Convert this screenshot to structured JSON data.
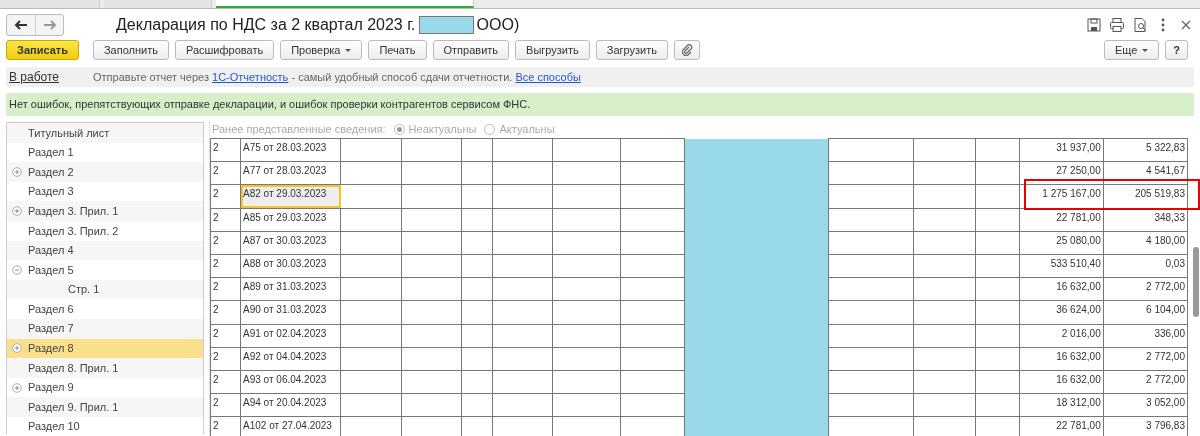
{
  "top_tabs": [
    {
      "selected": false
    },
    {
      "selected": false
    },
    {
      "selected": true
    }
  ],
  "window": {
    "title_before": "Декларация по НДС за 2 квартал 2023 г.",
    "title_after": "ООО)"
  },
  "toolbar": {
    "buttons": [
      {
        "label": "Записать",
        "kind": "primary"
      },
      {
        "label": "Заполнить",
        "kind": "plain"
      },
      {
        "label": "Расшифровать",
        "kind": "plain"
      },
      {
        "label": "Проверка",
        "kind": "dropdown"
      },
      {
        "label": "Печать",
        "kind": "plain"
      },
      {
        "label": "Отправить",
        "kind": "plain"
      },
      {
        "label": "Выгрузить",
        "kind": "plain"
      },
      {
        "label": "Загрузить",
        "kind": "plain"
      },
      {
        "kind": "attach"
      }
    ],
    "right_buttons": [
      {
        "label": "Еще",
        "kind": "dropdown"
      },
      {
        "label": "?",
        "kind": "help"
      }
    ]
  },
  "info_bar": {
    "status": "В работе",
    "text_before": "Отправьте отчет через",
    "link": "1С-Отчетность",
    "text_after": "- самый удобный способ сдачи отчетности.",
    "link_all": "Все способы"
  },
  "message": "Нет ошибок, препятствующих отправке декларации, и ошибок проверки контрагентов сервисом ФНС.",
  "sidebar": {
    "items": [
      {
        "label": "Титульный лист",
        "selected": false
      },
      {
        "label": "Раздел 1",
        "selected": false
      },
      {
        "label": "Раздел 2",
        "selected": false,
        "expanded": false
      },
      {
        "label": "Раздел 3",
        "selected": false
      },
      {
        "label": "Раздел 3. Прил. 1",
        "selected": false,
        "expanded": false
      },
      {
        "label": "Раздел 3. Прил. 2",
        "selected": false
      },
      {
        "label": "Раздел 4",
        "selected": false
      },
      {
        "label": "Раздел 5",
        "selected": false,
        "expanded": true,
        "children": [
          {
            "label": "Стр. 1",
            "selected": false
          }
        ]
      },
      {
        "label": "Раздел 6",
        "selected": false
      },
      {
        "label": "Раздел 7",
        "selected": false
      },
      {
        "label": "Раздел 8",
        "selected": true,
        "expanded": false
      },
      {
        "label": "Раздел 8. Прил. 1",
        "selected": false
      },
      {
        "label": "Раздел 9",
        "selected": false,
        "expanded": false
      },
      {
        "label": "Раздел 9. Прил. 1",
        "selected": false
      },
      {
        "label": "Раздел 10",
        "selected": false
      }
    ]
  },
  "previous_info": {
    "label": "Ранее представленные сведения:",
    "disabled": true,
    "options": [
      {
        "label": "Неактуальны",
        "selected": true
      },
      {
        "label": "Актуальны",
        "selected": false
      }
    ]
  },
  "table": {
    "rows": [
      {
        "column_1": "2",
        "document": "А75 от 28.03.2023",
        "amount": "31 937,00",
        "tax": "5 322,83",
        "selected": false,
        "marked": false
      },
      {
        "column_1": "2",
        "document": "А77 от 28.03.2023",
        "amount": "27 250,00",
        "tax": "4 541,67",
        "selected": false,
        "marked": false
      },
      {
        "column_1": "2",
        "document": "А82 от 29.03.2023",
        "amount": "1 275 167,00",
        "tax": "205 519,83",
        "selected": true,
        "marked": true
      },
      {
        "column_1": "2",
        "document": "А85 от 29.03.2023",
        "amount": "22 781,00",
        "tax": "348,33",
        "selected": false,
        "marked": false
      },
      {
        "column_1": "2",
        "document": "А87 от 30.03.2023",
        "amount": "25 080,00",
        "tax": "4 180,00",
        "selected": false,
        "marked": false
      },
      {
        "column_1": "2",
        "document": "А88 от 30.03.2023",
        "amount": "533 510,40",
        "tax": "0,03",
        "selected": false,
        "marked": false
      },
      {
        "column_1": "2",
        "document": "А89 от 31.03.2023",
        "amount": "16 632,00",
        "tax": "2 772,00",
        "selected": false,
        "marked": false
      },
      {
        "column_1": "2",
        "document": "А90 от 31.03.2023",
        "amount": "36 624,00",
        "tax": "6 104,00",
        "selected": false,
        "marked": false
      },
      {
        "column_1": "2",
        "document": "А91 от 02.04.2023",
        "amount": "2 016,00",
        "tax": "336,00",
        "selected": false,
        "marked": false
      },
      {
        "column_1": "2",
        "document": "А92 от 04.04.2023",
        "amount": "16 632,00",
        "tax": "2 772,00",
        "selected": false,
        "marked": false
      },
      {
        "column_1": "2",
        "document": "А93 от 06.04.2023",
        "amount": "16 632,00",
        "tax": "2 772,00",
        "selected": false,
        "marked": false
      },
      {
        "column_1": "2",
        "document": "А94 от 20.04.2023",
        "amount": "18 312,00",
        "tax": "3 052,00",
        "selected": false,
        "marked": false
      },
      {
        "column_1": "2",
        "document": "А102 от 27.04.2023",
        "amount": "22 781,00",
        "tax": "3 796,83",
        "selected": false,
        "marked": false
      }
    ]
  }
}
